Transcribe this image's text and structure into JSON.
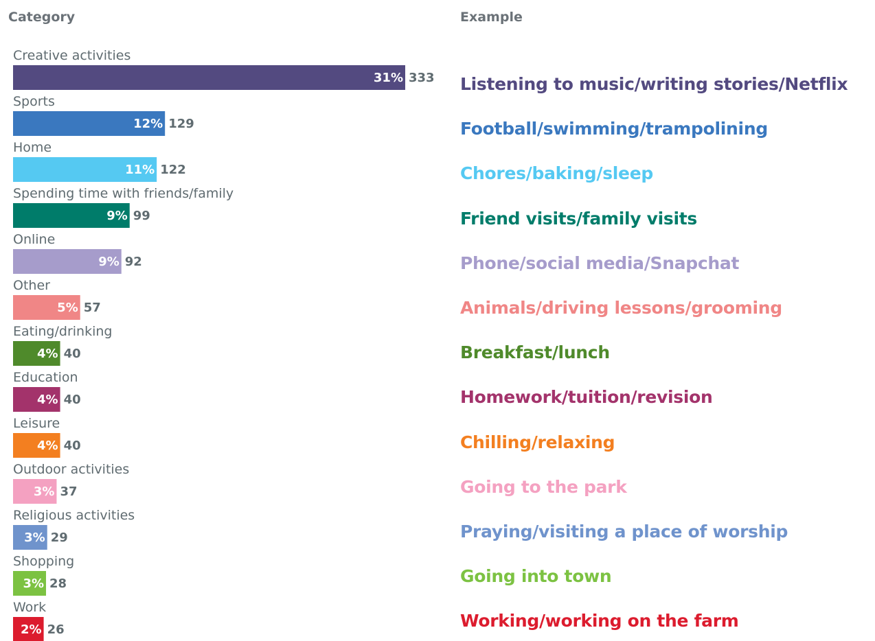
{
  "headers": {
    "category": "Category",
    "example": "Example"
  },
  "chart_data": {
    "type": "bar",
    "orientation": "horizontal",
    "categories": [
      "Creative activities",
      "Sports",
      "Home",
      "Spending time with friends/family",
      "Online",
      "Other",
      "Eating/drinking",
      "Education",
      "Leisure",
      "Outdoor activities",
      "Religious activities",
      "Shopping",
      "Work"
    ],
    "values": [
      333,
      129,
      122,
      99,
      92,
      57,
      40,
      40,
      40,
      37,
      29,
      28,
      26
    ],
    "percent_labels": [
      "31%",
      "12%",
      "11%",
      "9%",
      "9%",
      "5%",
      "4%",
      "4%",
      "4%",
      "3%",
      "3%",
      "3%",
      "2%"
    ],
    "colors": [
      "#534a80",
      "#3a78bf",
      "#55c9f2",
      "#007c6a",
      "#a69ccb",
      "#f08686",
      "#4f8a2b",
      "#a3336b",
      "#f37f20",
      "#f4a1c1",
      "#6f93cc",
      "#7cc242",
      "#dc1c2e"
    ],
    "xlim": [
      0,
      333
    ],
    "grid": false,
    "legend": "none",
    "examples": [
      "Listening to music/writing stories/Netflix",
      "Football/swimming/trampolining",
      "Chores/baking/sleep",
      "Friend visits/family visits",
      "Phone/social media/Snapchat",
      "Animals/driving lessons/grooming",
      "Breakfast/lunch",
      "Homework/tuition/revision",
      "Chilling/relaxing",
      "Going to the park",
      "Praying/visiting a place of worship",
      "Going into town",
      "Working/working on the farm"
    ]
  }
}
